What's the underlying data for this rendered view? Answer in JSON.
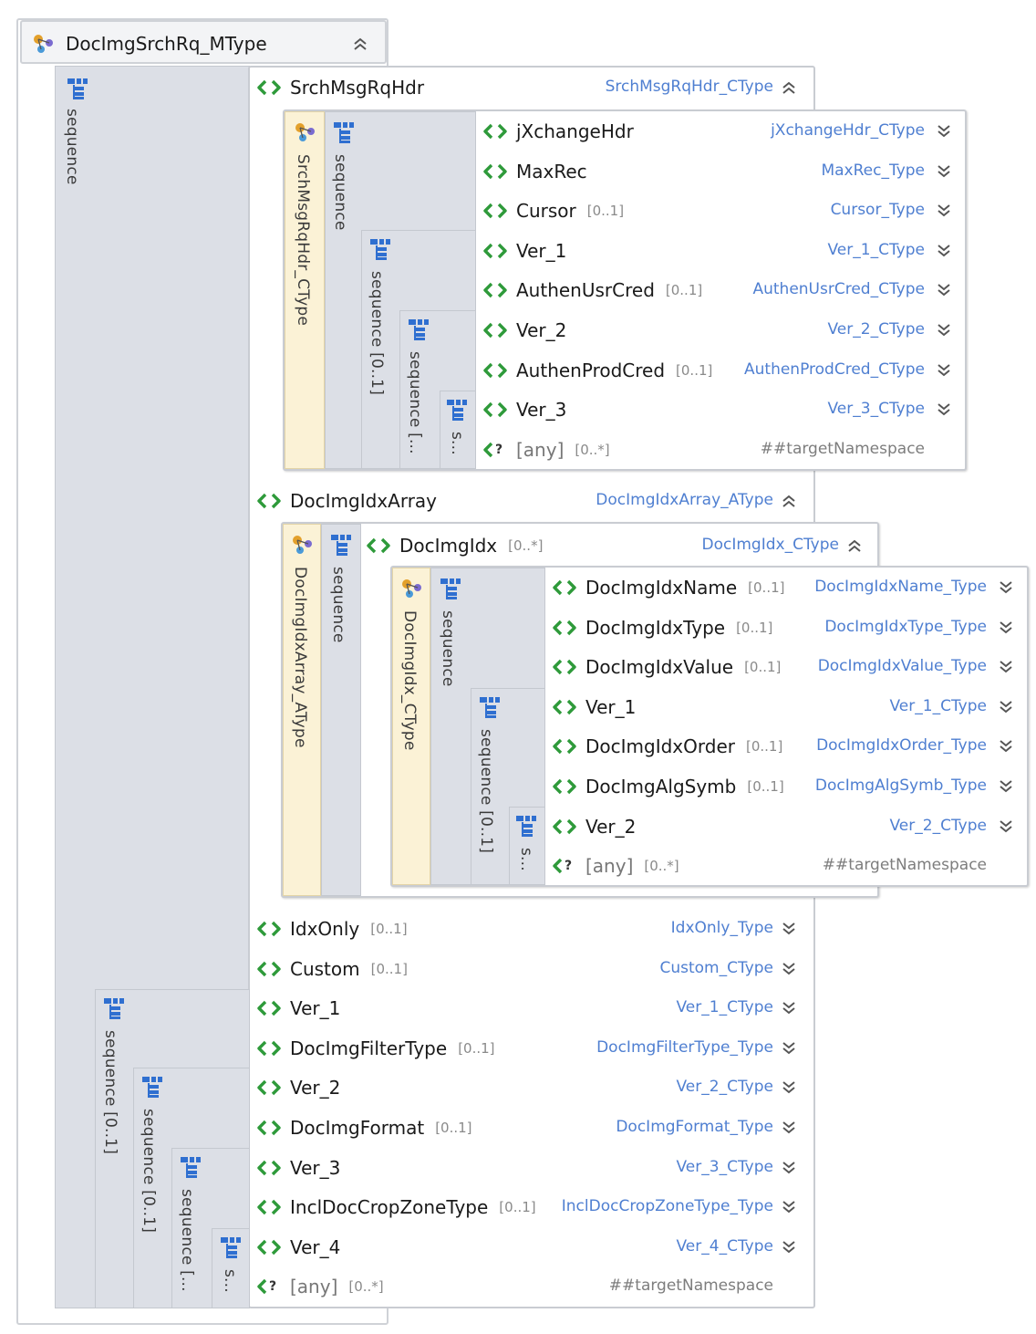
{
  "root": {
    "title": "DocImgSrchRq_MType"
  },
  "outer_sequence": {
    "label": "sequence"
  },
  "srch": {
    "name": "SrchMsgRqHdr",
    "type": "SrchMsgRqHdr_CType",
    "type_label": "SrchMsgRqHdr_CType",
    "seq1": "sequence",
    "seq2": "sequence  [0..1]",
    "seq3": "sequence  [...",
    "seq4": "s...",
    "rows": [
      {
        "name": "jXchangeHdr",
        "card": "",
        "type": "jXchangeHdr_CType"
      },
      {
        "name": "MaxRec",
        "card": "",
        "type": "MaxRec_Type"
      },
      {
        "name": "Cursor",
        "card": "[0..1]",
        "type": "Cursor_Type"
      },
      {
        "name": "Ver_1",
        "card": "",
        "type": "Ver_1_CType"
      },
      {
        "name": "AuthenUsrCred",
        "card": "[0..1]",
        "type": "AuthenUsrCred_CType"
      },
      {
        "name": "Ver_2",
        "card": "",
        "type": "Ver_2_CType"
      },
      {
        "name": "AuthenProdCred",
        "card": "[0..1]",
        "type": "AuthenProdCred_CType"
      },
      {
        "name": "Ver_3",
        "card": "",
        "type": "Ver_3_CType"
      },
      {
        "name": "[any]",
        "card": "[0..*]",
        "type": "##targetNamespace"
      }
    ]
  },
  "idxarray": {
    "name": "DocImgIdxArray",
    "type": "DocImgIdxArray_AType",
    "type_label": "DocImgIdxArray_AType",
    "seq": "sequence",
    "idx": {
      "name": "DocImgIdx",
      "card": "[0..*]",
      "type": "DocImgIdx_CType",
      "type_label": "DocImgIdx_CType",
      "seq1": "sequence",
      "seq2": "sequence  [0..1]",
      "seq3": "s...",
      "rows": [
        {
          "name": "DocImgIdxName",
          "card": "[0..1]",
          "type": "DocImgIdxName_Type"
        },
        {
          "name": "DocImgIdxType",
          "card": "[0..1]",
          "type": "DocImgIdxType_Type"
        },
        {
          "name": "DocImgIdxValue",
          "card": "[0..1]",
          "type": "DocImgIdxValue_Type"
        },
        {
          "name": "Ver_1",
          "card": "",
          "type": "Ver_1_CType"
        },
        {
          "name": "DocImgIdxOrder",
          "card": "[0..1]",
          "type": "DocImgIdxOrder_Type"
        },
        {
          "name": "DocImgAlgSymb",
          "card": "[0..1]",
          "type": "DocImgAlgSymb_Type"
        },
        {
          "name": "Ver_2",
          "card": "",
          "type": "Ver_2_CType"
        },
        {
          "name": "[any]",
          "card": "[0..*]",
          "type": "##targetNamespace"
        }
      ]
    }
  },
  "lower": {
    "seq1": "sequence  [0..1]",
    "seq2": "sequence  [0..1]",
    "seq3": "sequence  [...",
    "seq4": "s...",
    "rows": [
      {
        "name": "IdxOnly",
        "card": "[0..1]",
        "type": "IdxOnly_Type"
      },
      {
        "name": "Custom",
        "card": "[0..1]",
        "type": "Custom_CType"
      },
      {
        "name": "Ver_1",
        "card": "",
        "type": "Ver_1_CType"
      },
      {
        "name": "DocImgFilterType",
        "card": "[0..1]",
        "type": "DocImgFilterType_Type"
      },
      {
        "name": "Ver_2",
        "card": "",
        "type": "Ver_2_CType"
      },
      {
        "name": "DocImgFormat",
        "card": "[0..1]",
        "type": "DocImgFormat_Type"
      },
      {
        "name": "Ver_3",
        "card": "",
        "type": "Ver_3_CType"
      },
      {
        "name": "InclDocCropZoneType",
        "card": "[0..1]",
        "type": "InclDocCropZoneType_Type"
      },
      {
        "name": "Ver_4",
        "card": "",
        "type": "Ver_4_CType"
      },
      {
        "name": "[any]",
        "card": "[0..*]",
        "type": "##targetNamespace"
      }
    ]
  },
  "colors": {
    "accent": "#4f7fd1",
    "element_icon": "#2e9a3a",
    "sequence_bg": "#dcdfe6",
    "complex_type_bg": "#fbf2d6"
  }
}
